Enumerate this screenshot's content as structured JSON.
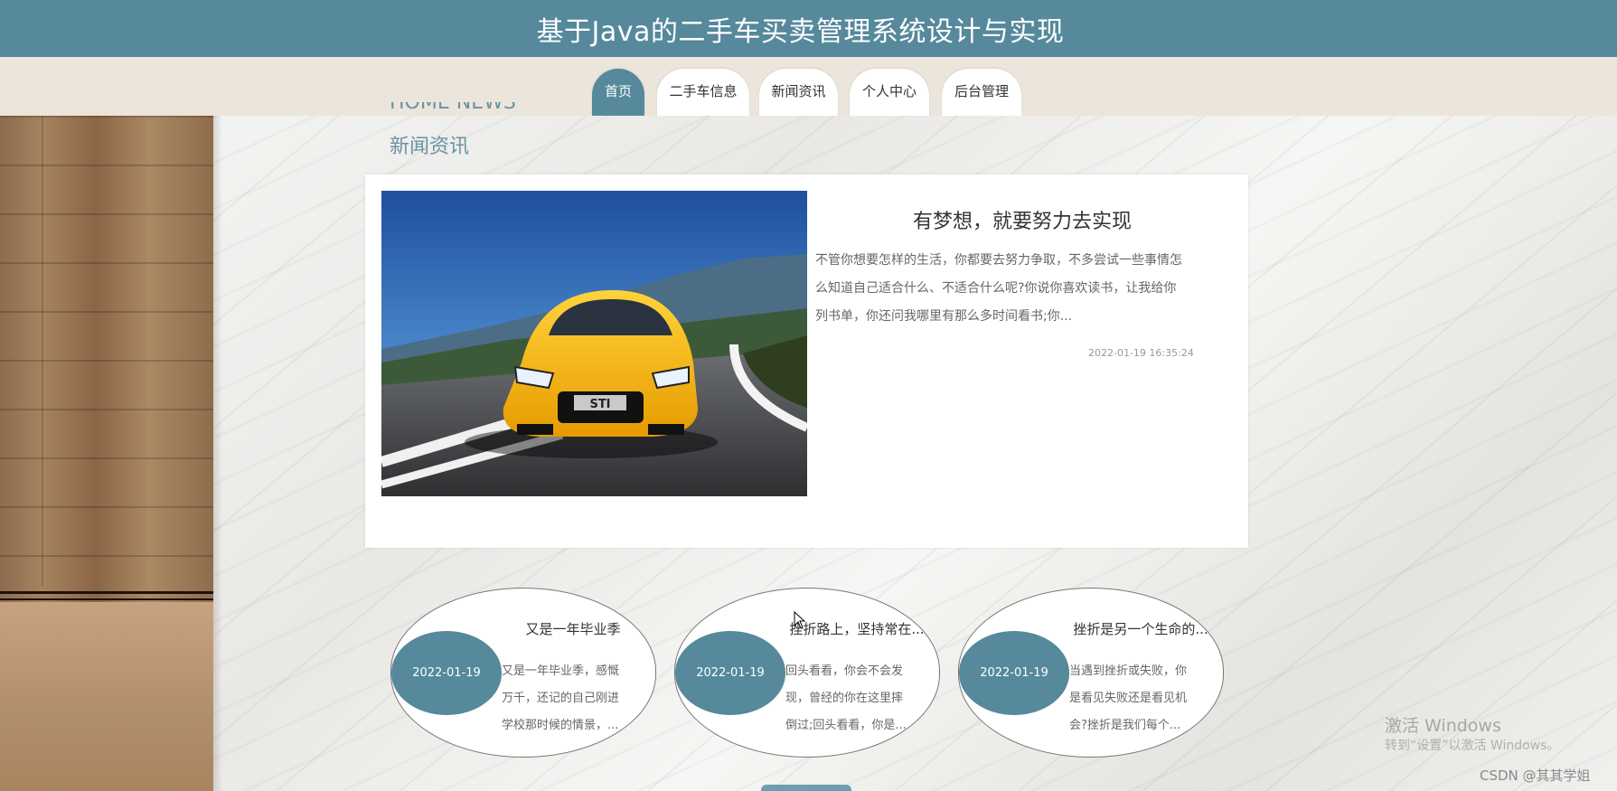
{
  "header": {
    "title": "基于Java的二手车买卖管理系统设计与实现"
  },
  "nav": {
    "items": [
      {
        "label": "首页",
        "active": true
      },
      {
        "label": "二手车信息",
        "active": false
      },
      {
        "label": "新闻资讯",
        "active": false
      },
      {
        "label": "个人中心",
        "active": false
      },
      {
        "label": "后台管理",
        "active": false
      }
    ]
  },
  "section": {
    "title_en": "HOME NEWS",
    "title_cn": "新闻资讯"
  },
  "featured": {
    "title": "有梦想，就要努力去实现",
    "text": "不管你想要怎样的生活，你都要去努力争取，不多尝试一些事情怎么知道自己适合什么、不适合什么呢?你说你喜欢读书，让我给你列书单，你还问我哪里有那么多时间看书;你...",
    "date": "2022-01-19 16:35:24",
    "image_alt": "yellow car"
  },
  "news": [
    {
      "date": "2022-01-19",
      "title": "又是一年毕业季",
      "text": "又是一年毕业季，感慨万千，还记的自己刚进学校那时候的情景，..."
    },
    {
      "date": "2022-01-19",
      "title": "挫折路上，坚持常在...",
      "text": "回头看看，你会不会发现，曾经的你在这里摔倒过;回头看看，你是..."
    },
    {
      "date": "2022-01-19",
      "title": "挫折是另一个生命的...",
      "text": "当遇到挫折或失败，你是看见失败还是看见机会?挫折是我们每个..."
    }
  ],
  "watermark": {
    "line1": "激活 Windows",
    "line2": "转到“设置”以激活 Windows。"
  },
  "credit": "CSDN @其其学姐",
  "colors": {
    "primary": "#55899b",
    "nav_bg": "#ebe5db"
  }
}
